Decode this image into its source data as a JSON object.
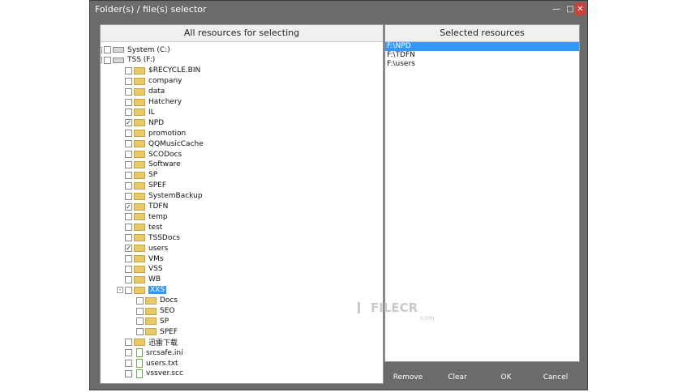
{
  "window": {
    "title": "Folder(s) / file(s) selector"
  },
  "left_panel": {
    "header": "All resources for selecting",
    "tree": [
      {
        "label": "System (C:)",
        "kind": "drive",
        "checked": false,
        "level": 0,
        "expander": "+"
      },
      {
        "label": "TSS (F:)",
        "kind": "drive",
        "checked": false,
        "level": 0,
        "expander": "-"
      },
      {
        "label": "$RECYCLE.BIN",
        "kind": "folder",
        "checked": false,
        "level": 1
      },
      {
        "label": "company",
        "kind": "folder",
        "checked": false,
        "level": 1
      },
      {
        "label": "data",
        "kind": "folder",
        "checked": false,
        "level": 1
      },
      {
        "label": "Hatchery",
        "kind": "folder",
        "checked": false,
        "level": 1
      },
      {
        "label": "IL",
        "kind": "folder",
        "checked": false,
        "level": 1
      },
      {
        "label": "NPD",
        "kind": "folder",
        "checked": true,
        "level": 1
      },
      {
        "label": "promotion",
        "kind": "folder",
        "checked": false,
        "level": 1
      },
      {
        "label": "QQMusicCache",
        "kind": "folder",
        "checked": false,
        "level": 1
      },
      {
        "label": "SCODocs",
        "kind": "folder",
        "checked": false,
        "level": 1
      },
      {
        "label": "Software",
        "kind": "folder",
        "checked": false,
        "level": 1
      },
      {
        "label": "SP",
        "kind": "folder",
        "checked": false,
        "level": 1
      },
      {
        "label": "SPEF",
        "kind": "folder",
        "checked": false,
        "level": 1
      },
      {
        "label": "SystemBackup",
        "kind": "folder",
        "checked": false,
        "level": 1
      },
      {
        "label": "TDFN",
        "kind": "folder",
        "checked": true,
        "level": 1
      },
      {
        "label": "temp",
        "kind": "folder",
        "checked": false,
        "level": 1
      },
      {
        "label": "test",
        "kind": "folder",
        "checked": false,
        "level": 1
      },
      {
        "label": "TSSDocs",
        "kind": "folder",
        "checked": false,
        "level": 1
      },
      {
        "label": "users",
        "kind": "folder",
        "checked": true,
        "level": 1
      },
      {
        "label": "VMs",
        "kind": "folder",
        "checked": false,
        "level": 1
      },
      {
        "label": "VSS",
        "kind": "folder",
        "checked": false,
        "level": 1
      },
      {
        "label": "WB",
        "kind": "folder",
        "checked": false,
        "level": 1
      },
      {
        "label": "XXS",
        "kind": "folder",
        "checked": false,
        "level": 1,
        "expander": "-",
        "selected": true
      },
      {
        "label": "Docs",
        "kind": "folder",
        "checked": false,
        "level": 2
      },
      {
        "label": "SEO",
        "kind": "folder",
        "checked": false,
        "level": 2
      },
      {
        "label": "SP",
        "kind": "folder",
        "checked": false,
        "level": 2
      },
      {
        "label": "SPEF",
        "kind": "folder",
        "checked": false,
        "level": 2
      },
      {
        "label": "迅雷下载",
        "kind": "folder",
        "checked": false,
        "level": 1
      },
      {
        "label": "srcsafe.ini",
        "kind": "file",
        "checked": false,
        "level": 1
      },
      {
        "label": "users.txt",
        "kind": "file",
        "checked": false,
        "level": 1
      },
      {
        "label": "vssver.scc",
        "kind": "file",
        "checked": false,
        "level": 1
      }
    ]
  },
  "right_panel": {
    "header": "Selected resources",
    "items": [
      {
        "label": "F:\\NPD",
        "selected": true
      },
      {
        "label": "F:\\TDFN",
        "selected": false
      },
      {
        "label": "F:\\users",
        "selected": false
      }
    ]
  },
  "buttons": {
    "remove": "Remove",
    "clear": "Clear",
    "ok": "OK",
    "cancel": "Cancel"
  },
  "watermark": {
    "text": "FILECR",
    "sub": ".com"
  },
  "window_controls": {
    "minimize": "—",
    "maximize": "□",
    "close": "✕"
  }
}
